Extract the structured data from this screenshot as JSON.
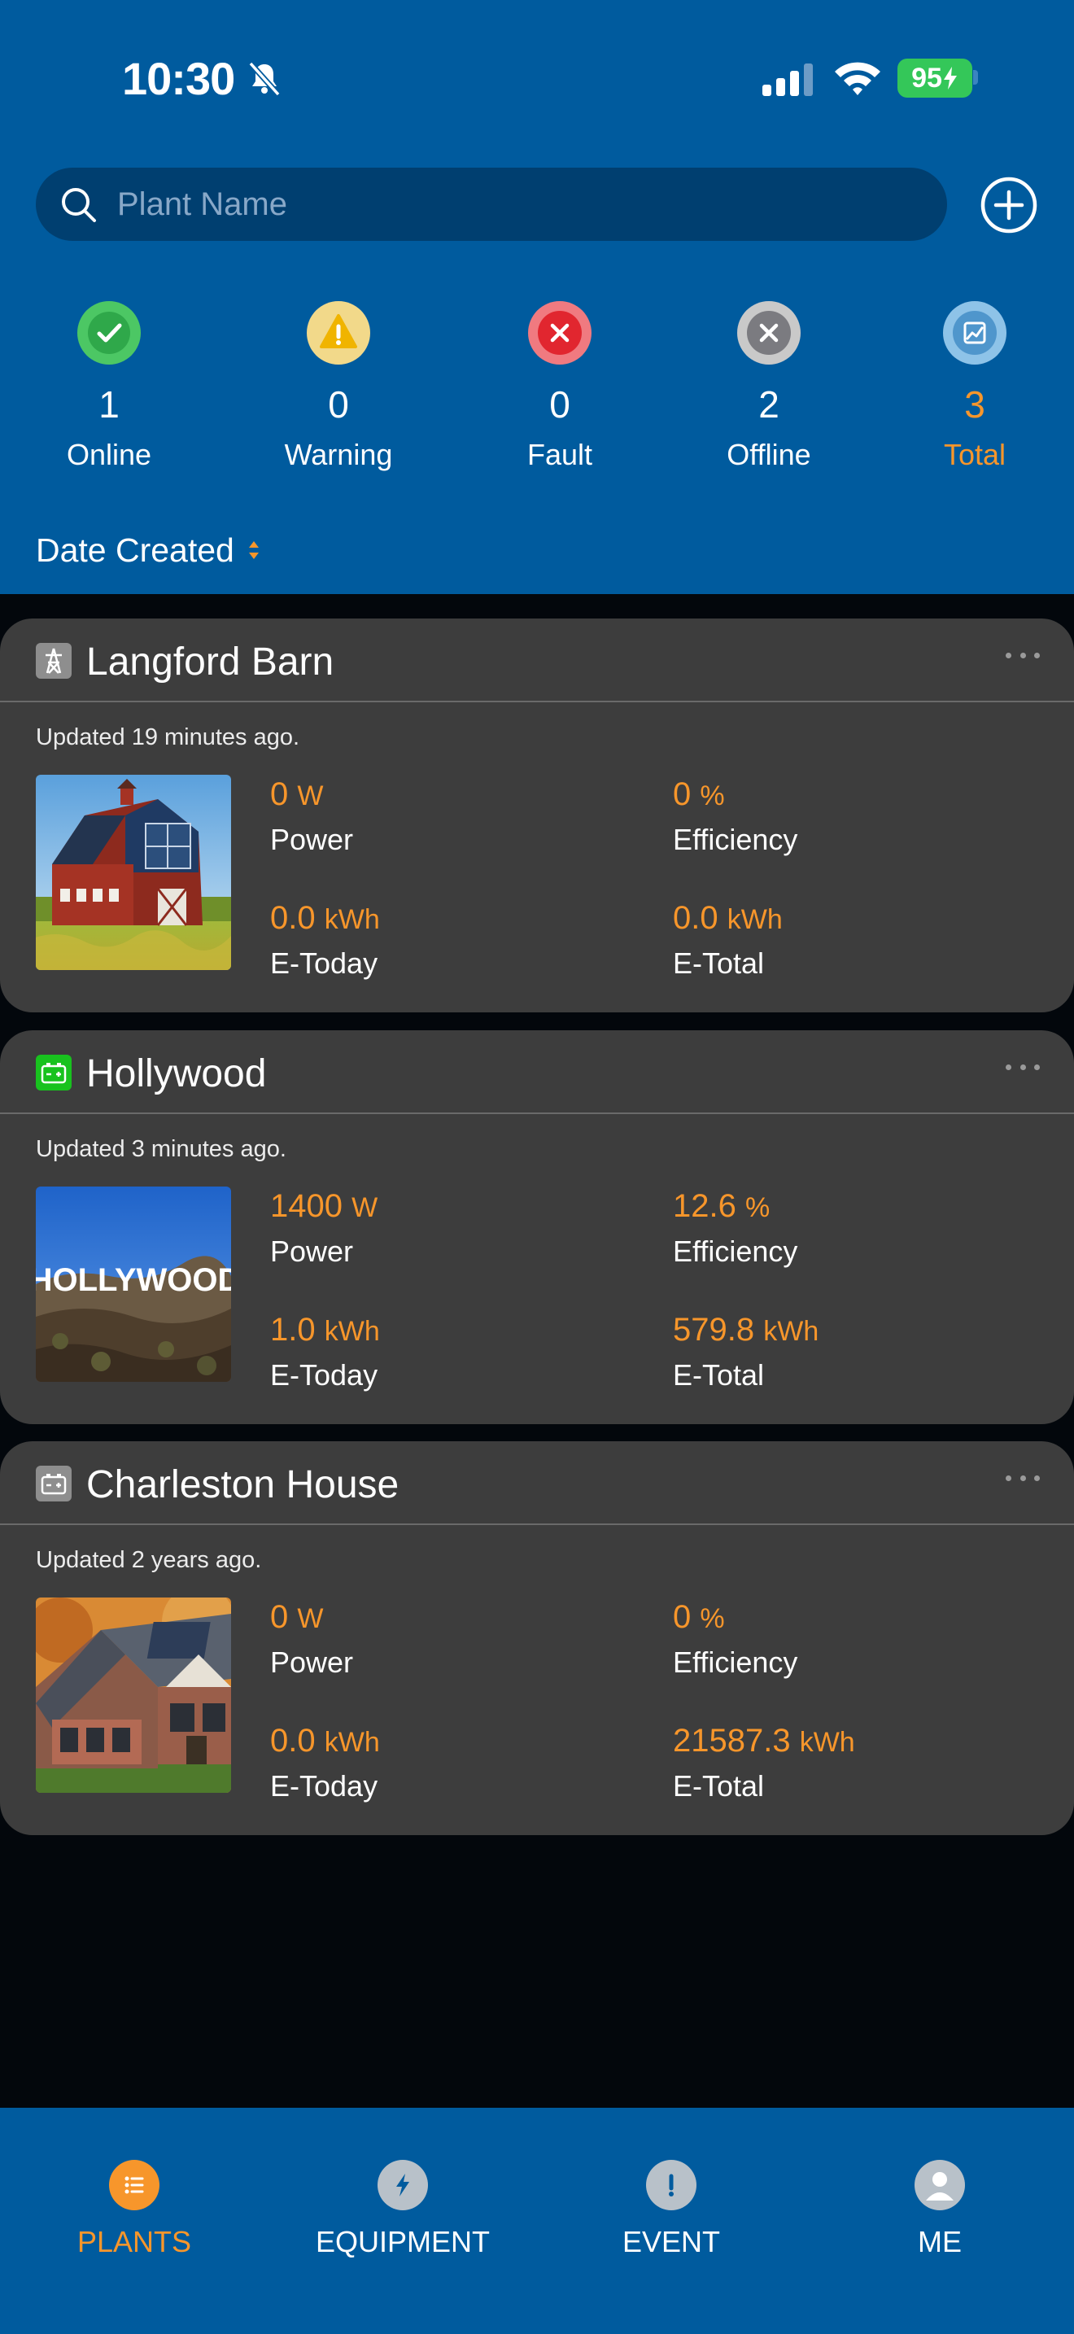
{
  "status_bar": {
    "time": "10:30",
    "battery": "95"
  },
  "search": {
    "placeholder": "Plant Name"
  },
  "summary": {
    "online": {
      "count": "1",
      "label": "Online",
      "color": "#4cc764"
    },
    "warning": {
      "count": "0",
      "label": "Warning",
      "color": "#f2d15c"
    },
    "fault": {
      "count": "0",
      "label": "Fault",
      "color": "#e8424a"
    },
    "offline": {
      "count": "2",
      "label": "Offline",
      "color": "#8e8e93"
    },
    "total": {
      "count": "3",
      "label": "Total",
      "color": "#5fa3d6"
    }
  },
  "sort": {
    "label": "Date Created"
  },
  "plants": [
    {
      "name": "Langford Barn",
      "type_icon": "transmission-tower-icon",
      "type_icon_color": "#8e8e8e",
      "updated": "Updated 19 minutes ago.",
      "power": {
        "value": "0",
        "unit": "W",
        "label": "Power"
      },
      "efficiency": {
        "value": "0",
        "unit": "%",
        "label": "Efficiency"
      },
      "e_today": {
        "value": "0.0",
        "unit": "kWh",
        "label": "E-Today"
      },
      "e_total": {
        "value": "0.0",
        "unit": "kWh",
        "label": "E-Total"
      }
    },
    {
      "name": "Hollywood",
      "type_icon": "battery-icon",
      "type_icon_color": "#18c21e",
      "updated": "Updated 3 minutes ago.",
      "photo_text": "HOLLYWOOD",
      "power": {
        "value": "1400",
        "unit": "W",
        "label": "Power"
      },
      "efficiency": {
        "value": "12.6",
        "unit": "%",
        "label": "Efficiency"
      },
      "e_today": {
        "value": "1.0",
        "unit": "kWh",
        "label": "E-Today"
      },
      "e_total": {
        "value": "579.8",
        "unit": "kWh",
        "label": "E-Total"
      }
    },
    {
      "name": "Charleston House",
      "type_icon": "battery-icon",
      "type_icon_color": "#8e8e8e",
      "updated": "Updated 2 years ago.",
      "power": {
        "value": "0",
        "unit": "W",
        "label": "Power"
      },
      "efficiency": {
        "value": "0",
        "unit": "%",
        "label": "Efficiency"
      },
      "e_today": {
        "value": "0.0",
        "unit": "kWh",
        "label": "E-Today"
      },
      "e_total": {
        "value": "21587.3",
        "unit": "kWh",
        "label": "E-Total"
      }
    }
  ],
  "tabs": [
    {
      "label": "PLANTS",
      "icon": "list-icon",
      "active": true
    },
    {
      "label": "EQUIPMENT",
      "icon": "lightning-icon",
      "active": false
    },
    {
      "label": "EVENT",
      "icon": "exclamation-icon",
      "active": false
    },
    {
      "label": "ME",
      "icon": "person-icon",
      "active": false
    }
  ],
  "colors": {
    "header_bg": "#005b9e",
    "accent": "#f7962b",
    "card_bg": "#3d3d3d",
    "page_bg": "#03070c"
  }
}
